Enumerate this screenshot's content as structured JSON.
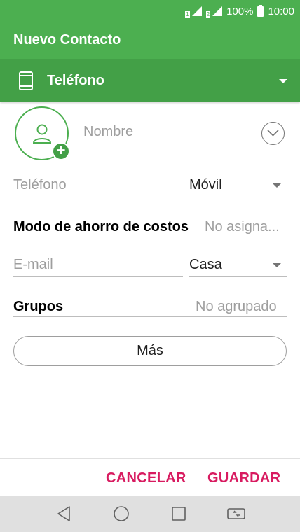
{
  "status_bar": {
    "battery_percent": "100%",
    "time": "10:00",
    "sim_labels": [
      "1",
      "2"
    ]
  },
  "app_bar": {
    "title": "Nuevo Contacto"
  },
  "account": {
    "label": "Teléfono",
    "icon": "phone-icon"
  },
  "form": {
    "name_placeholder": "Nombre",
    "phone": {
      "placeholder": "Teléfono",
      "type": "Móvil"
    },
    "cost_saving": {
      "label": "Modo de ahorro de costos",
      "value": "No asigna..."
    },
    "email": {
      "placeholder": "E-mail",
      "type": "Casa"
    },
    "groups": {
      "label": "Grupos",
      "value": "No agrupado"
    },
    "more_button": "Más"
  },
  "actions": {
    "cancel": "CANCELAR",
    "save": "GUARDAR"
  },
  "nav": {
    "items": [
      "back-icon",
      "home-icon",
      "recents-icon",
      "dual-window-icon"
    ]
  },
  "colors": {
    "primary": "#4caf50",
    "primary_dark": "#43a047",
    "accent": "#d81b60"
  }
}
